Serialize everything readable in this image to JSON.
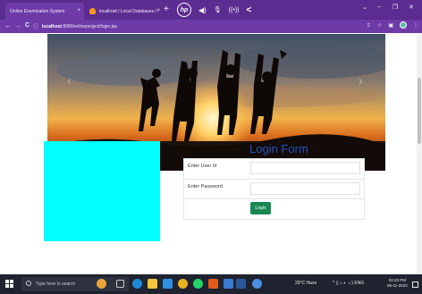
{
  "browser": {
    "tabs": [
      {
        "title": "Online Examination System",
        "close": "×"
      },
      {
        "title": "localhost / Local Databases / ex",
        "close": "×"
      }
    ],
    "new_tab": "+",
    "window_controls": {
      "chevron": "⌄",
      "minimize": "–",
      "restore": "❐",
      "close": "✕"
    },
    "media": {
      "brand": "hp",
      "volume": "◀)",
      "mic": "🎙",
      "broadcast": "((•))",
      "back": "<"
    },
    "nav": {
      "back": "←",
      "forward": "→",
      "reload": "C",
      "info": "ⓘ"
    },
    "url_host": "localhost",
    "url_path": ":8080/onlineproject/login.jsp",
    "bar_icons": {
      "share": "⇪",
      "star": "☆",
      "sidebar": "▣",
      "profile_initial": "B",
      "menu": "⋮"
    }
  },
  "hero": {
    "prev_arrow": "‹",
    "next_arrow": "›"
  },
  "login": {
    "title": "Login Form",
    "user_label": "Enter User Id",
    "password_label": "Enter Password",
    "user_value": "",
    "password_value": "",
    "button": "Login"
  },
  "taskbar": {
    "search_placeholder": "Type here to search",
    "weather": "29°C Haze",
    "tray": "^ ▯ ⌂ ◐ ☼) ENG",
    "time": "02:23 PM",
    "date": "05-11-2023"
  },
  "colors": {
    "browser_frame": "#5c2d91",
    "accent_title": "#2a51c0",
    "login_button": "#198754",
    "cyan_box": "#00ffff",
    "taskbar": "#1f2330"
  }
}
